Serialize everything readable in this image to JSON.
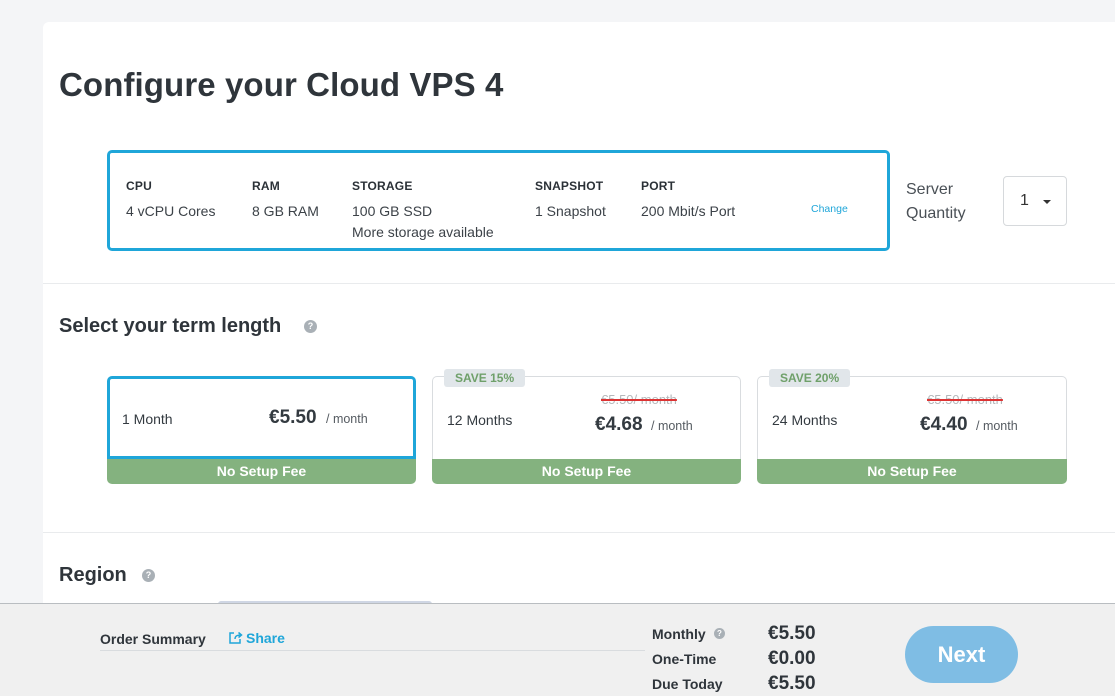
{
  "page": {
    "title": "Configure your Cloud VPS 4"
  },
  "config": {
    "specs": [
      {
        "label": "CPU",
        "value": "4 vCPU Cores",
        "extra": ""
      },
      {
        "label": "RAM",
        "value": "8 GB RAM",
        "extra": ""
      },
      {
        "label": "STORAGE",
        "value": "100 GB SSD",
        "extra": "More storage available"
      },
      {
        "label": "SNAPSHOT",
        "value": "1 Snapshot",
        "extra": ""
      },
      {
        "label": "PORT",
        "value": "200 Mbit/s Port",
        "extra": ""
      }
    ],
    "change_label": "Change"
  },
  "quantity": {
    "label_line1": "Server",
    "label_line2": "Quantity",
    "value": "1"
  },
  "term": {
    "title": "Select your term length",
    "help": "?",
    "options": [
      {
        "name": "1 Month",
        "save": "",
        "old_price": "",
        "price": "€5.50",
        "per": "/ month",
        "fee": "No Setup Fee",
        "selected": true
      },
      {
        "name": "12 Months",
        "save": "SAVE 15%",
        "old_price": "€5.50/ month",
        "price": "€4.68",
        "per": "/ month",
        "fee": "No Setup Fee",
        "selected": false
      },
      {
        "name": "24 Months",
        "save": "SAVE 20%",
        "old_price": "€5.50/ month",
        "price": "€4.40",
        "per": "/ month",
        "fee": "No Setup Fee",
        "selected": false
      }
    ]
  },
  "region": {
    "title": "Region",
    "help": "?"
  },
  "summary": {
    "title": "Order Summary",
    "share_label": "Share",
    "monthly_label": "Monthly",
    "monthly_value": "€5.50",
    "onetime_label": "One-Time",
    "onetime_value": "€0.00",
    "today_label": "Due Today",
    "today_value": "€5.50",
    "next_label": "Next"
  },
  "colors": {
    "accent": "#1fa6d9",
    "fee_green": "#84b27f",
    "next_button": "#7fbde4"
  }
}
